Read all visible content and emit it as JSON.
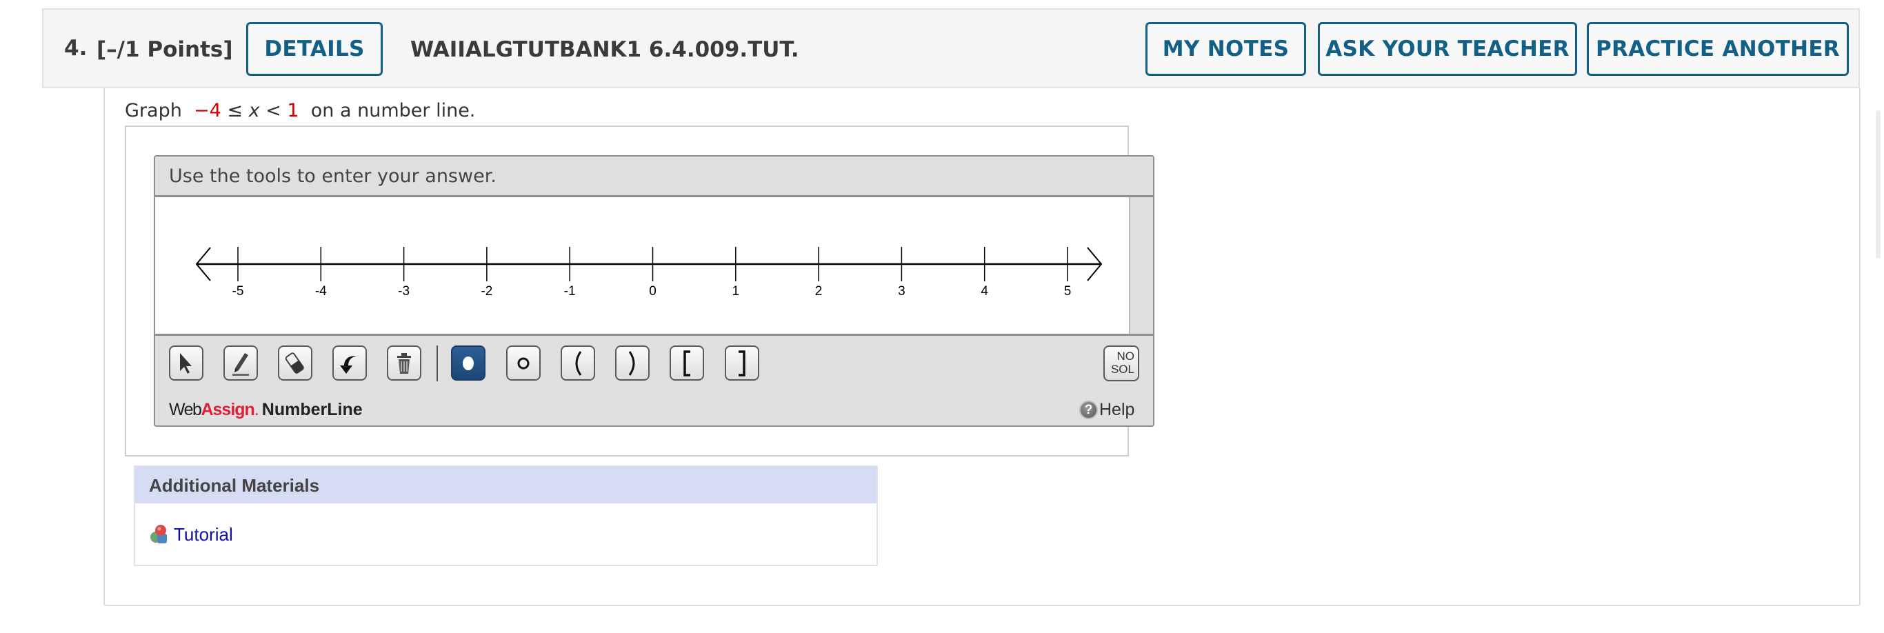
{
  "question": {
    "number": "4.",
    "points": "[–/1 Points]",
    "details_label": "DETAILS",
    "id": "WAIIALGTUTBANK1 6.4.009.TUT.",
    "actions": {
      "my_notes": "MY NOTES",
      "ask_teacher": "ASK YOUR TEACHER",
      "practice_another": "PRACTICE ANOTHER"
    },
    "prompt": {
      "before": "Graph",
      "lower": "−4",
      "op1": "≤",
      "var": "x",
      "op2": "<",
      "upper": "1",
      "after": "on a number line."
    }
  },
  "numberline": {
    "instructions": "Use the tools to enter your answer.",
    "ticks": [
      "-5",
      "-4",
      "-3",
      "-2",
      "-1",
      "0",
      "1",
      "2",
      "3",
      "4",
      "5"
    ],
    "tools": [
      {
        "name": "pointer-tool",
        "icon": "cursor-arrow-icon",
        "active": false
      },
      {
        "name": "pencil-tool",
        "icon": "pencil-icon",
        "active": false
      },
      {
        "name": "eraser-tool",
        "icon": "eraser-icon",
        "active": false
      },
      {
        "name": "undo-tool",
        "icon": "undo-icon",
        "active": false
      },
      {
        "name": "delete-tool",
        "icon": "trash-icon",
        "active": false
      },
      {
        "name": "closed-point-tool",
        "icon": "filled-circle-icon",
        "active": true
      },
      {
        "name": "open-point-tool",
        "icon": "open-circle-icon",
        "active": false
      },
      {
        "name": "left-paren-tool",
        "icon": "left-paren-icon",
        "active": false
      },
      {
        "name": "right-paren-tool",
        "icon": "right-paren-icon",
        "active": false
      },
      {
        "name": "left-bracket-tool",
        "icon": "left-bracket-icon",
        "active": false
      },
      {
        "name": "right-bracket-tool",
        "icon": "right-bracket-icon",
        "active": false
      }
    ],
    "no_solution": {
      "line1": "NO",
      "line2": "SOL"
    },
    "brand": {
      "web": "Web",
      "assign": "Assign",
      "dot": ".",
      "product": "NumberLine"
    },
    "help_label": "Help"
  },
  "additional_materials": {
    "title": "Additional Materials",
    "links": [
      {
        "label": "Tutorial",
        "icon": "tutorial-icon"
      }
    ]
  },
  "colors": {
    "accent": "#136087",
    "red_value": "#d00000",
    "brand_red": "#e0203a",
    "active_tool": "#1c4677",
    "materials_header": "#d6dcf3",
    "link": "#1010a8"
  }
}
